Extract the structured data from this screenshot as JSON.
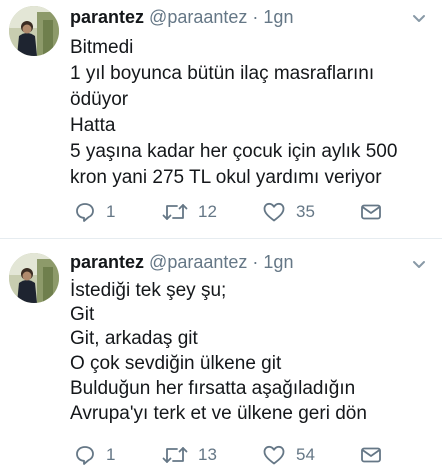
{
  "tweets": [
    {
      "display_name": "parantez",
      "handle": "@paraantez",
      "separator": "·",
      "time": "1gn",
      "lines": [
        "Bitmedi",
        "1 yıl boyunca bütün ilaç masraflarını",
        "ödüyor",
        "Hatta",
        "5 yaşına kadar her çocuk için aylık 500",
        "kron yani 275 TL okul yardımı veriyor"
      ],
      "reply_count": "1",
      "retweet_count": "12",
      "like_count": "35"
    },
    {
      "display_name": "parantez",
      "handle": "@paraantez",
      "separator": "·",
      "time": "1gn",
      "lines": [
        "İstediği tek şey şu;",
        "Git",
        "Git, arkadaş git",
        "O çok sevdiğin ülkene git",
        "Bulduğun her fırsatta aşağıladığın",
        "Avrupa'yı terk et ve ülkene geri dön"
      ],
      "reply_count": "1",
      "retweet_count": "13",
      "like_count": "54"
    }
  ],
  "icons": {
    "reply": "reply-icon",
    "retweet": "retweet-icon",
    "like": "heart-icon",
    "message": "direct-message-icon",
    "menu": "chevron-down-icon"
  },
  "colors": {
    "text": "#14171a",
    "secondary": "#657786",
    "divider": "#e6ecf0"
  }
}
